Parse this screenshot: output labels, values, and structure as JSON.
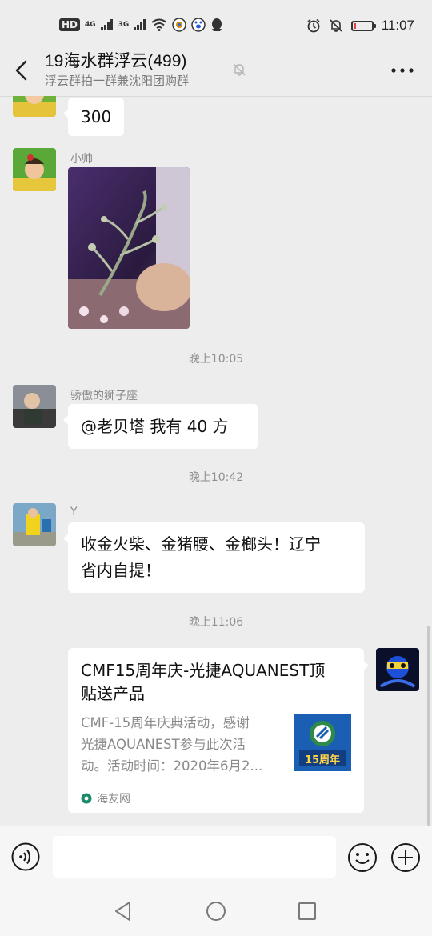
{
  "status_bar": {
    "hd_label": "HD",
    "net_1": "4G",
    "net_2": "3G",
    "time": "11:07",
    "battery_level_percent": 15
  },
  "header": {
    "title": "19海水群浮云(499)",
    "subtitle": "浮云群拍一群兼沈阳团购群",
    "back_icon": "chevron-left-icon",
    "mute_icon": "bell-off-icon",
    "more_icon": "more-dots-icon"
  },
  "messages": [
    {
      "type": "text",
      "text": "300"
    },
    {
      "type": "image",
      "sender": "小帅",
      "image_desc": "photo"
    },
    {
      "type": "time",
      "text": "晚上10:05"
    },
    {
      "type": "text",
      "sender": "骄傲的狮子座",
      "text": "@老贝塔  我有 40 方"
    },
    {
      "type": "time",
      "text": "晚上10:42"
    },
    {
      "type": "text",
      "sender": "Y",
      "text_line1": "收金火柴、金猪腰、金榔头！辽宁",
      "text_line2": "省内自提！"
    },
    {
      "type": "time",
      "text": "晚上11:06"
    },
    {
      "type": "link_card",
      "title_line1": "CMF15周年庆-光捷AQUANEST顶",
      "title_line2": "贴送产品",
      "desc_line1": "CMF-15周年庆典活动，感谢",
      "desc_line2": "光捷AQUANEST参与此次活",
      "desc_line3": "动。活动时间：2020年6月2...",
      "thumb_text": "15周年",
      "source": "海友网"
    }
  ],
  "input_bar": {
    "voice_icon": "voice-icon",
    "emoji_icon": "emoji-icon",
    "plus_icon": "plus-icon"
  },
  "nav_bar": {
    "back_icon": "nav-back-icon",
    "home_icon": "nav-home-icon",
    "recent_icon": "nav-recent-icon"
  },
  "colors": {
    "background": "#ededed",
    "bubble": "#ffffff",
    "link_blue": "#1a5fb4"
  }
}
